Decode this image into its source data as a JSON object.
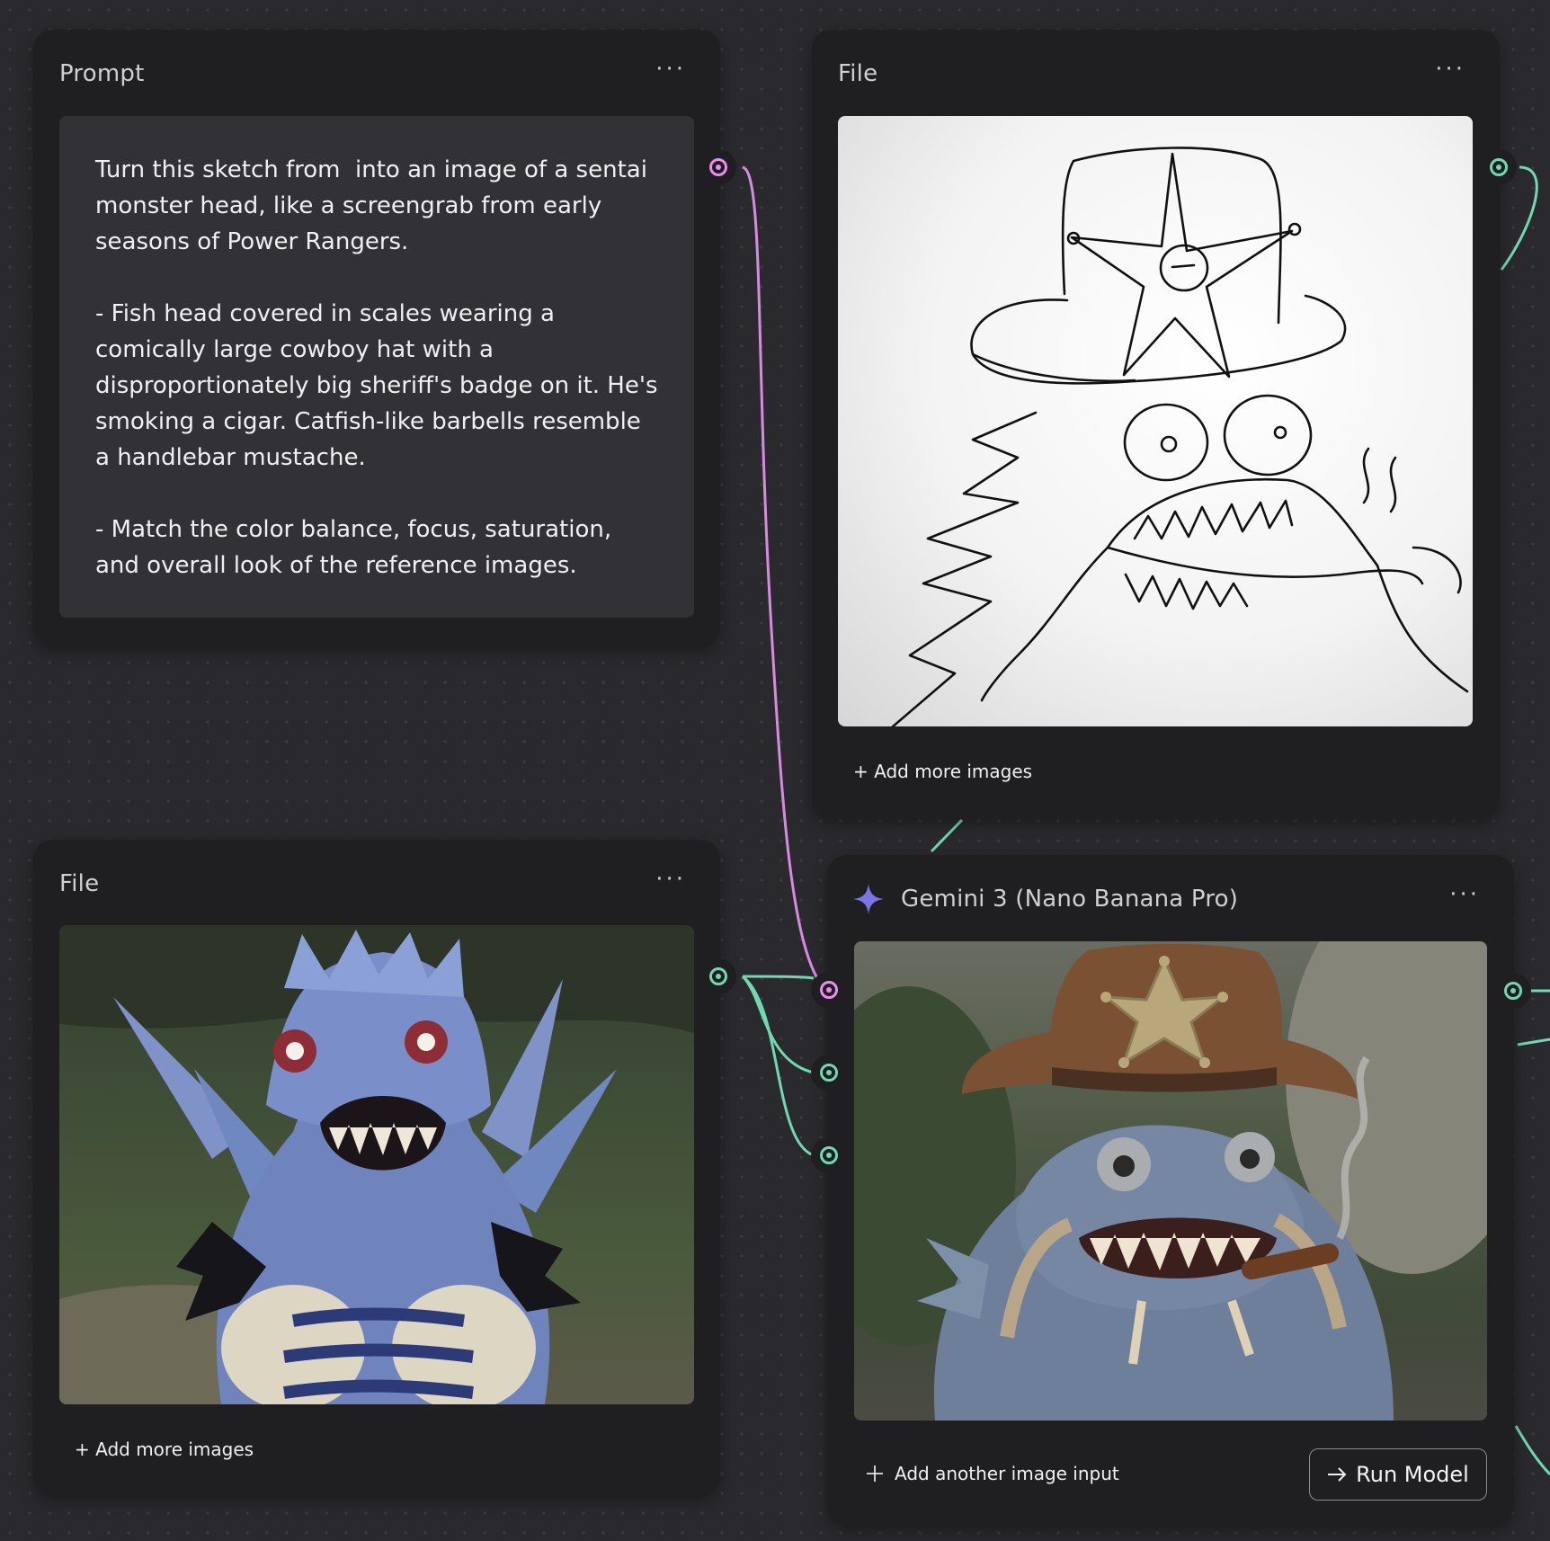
{
  "prompt_node": {
    "title": "Prompt",
    "menu": "···",
    "text": "Turn this sketch from  into an image of a sentai monster head, like a screengrab from early seasons of Power Rangers.\n\n- Fish head covered in scales wearing a comically large cowboy hat with a disproportionately big sheriff's badge on it. He's smoking a cigar. Catfish-like barbells resemble a handlebar mustache.\n\n- Match the color balance, focus, saturation, and overall look of the reference images."
  },
  "file_node_sketch": {
    "title": "File",
    "menu": "···",
    "add_label": "+ Add more images",
    "image": "sketch of a fish monster with cowboy hat and sheriff star"
  },
  "file_node_monster": {
    "title": "File",
    "menu": "···",
    "add_label": "+ Add more images",
    "image": "blue sentai monster costume in a forest"
  },
  "model_node": {
    "title": "Gemini 3 (Nano Banana Pro)",
    "icon": "sparkle-icon",
    "menu": "···",
    "add_input_label": "Add another image input",
    "run_label": "Run Model",
    "image": "generated fish monster wearing cowboy hat with star badge smoking cigar"
  },
  "colors": {
    "canvas": "#2a2a2e",
    "node": "#1f1f22",
    "text_port": "#ec8cf0",
    "image_port": "#6fd9b2",
    "sparkle": "#7b74e6"
  }
}
